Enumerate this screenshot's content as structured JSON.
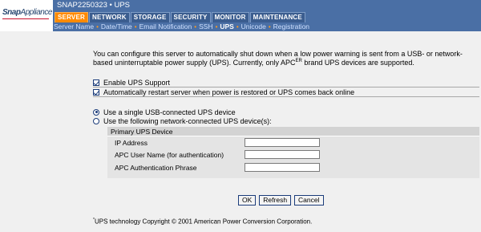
{
  "header": {
    "logo_text_bold": "Snap",
    "logo_text_light": "Appliance",
    "device_title": "SNAP2250323 • UPS"
  },
  "tabs": [
    {
      "label": "SERVER",
      "active": true
    },
    {
      "label": "NETWORK",
      "active": false
    },
    {
      "label": "STORAGE",
      "active": false
    },
    {
      "label": "SECURITY",
      "active": false
    },
    {
      "label": "MONITOR",
      "active": false
    },
    {
      "label": "MAINTENANCE",
      "active": false
    }
  ],
  "subnav": [
    {
      "label": "Server Name",
      "active": false
    },
    {
      "label": "Date/Time",
      "active": false
    },
    {
      "label": "Email Notification",
      "active": false
    },
    {
      "label": "SSH",
      "active": false
    },
    {
      "label": "UPS",
      "active": true
    },
    {
      "label": "Unicode",
      "active": false
    },
    {
      "label": "Registration",
      "active": false
    }
  ],
  "subnav_separator": "•",
  "intro": {
    "text_before": "You can configure this server to automatically shut down when a low power warning is sent from a USB- or network-based uninterruptable power supply (UPS). Currently, only APC",
    "superscript": "ER",
    "text_after": " brand UPS devices are supported."
  },
  "options": {
    "enable_ups": {
      "label": "Enable UPS Support",
      "checked": true
    },
    "auto_restart": {
      "label": "Automatically restart server when power is restored or UPS comes back online",
      "checked": true
    },
    "usb_device": {
      "label": "Use a single USB-connected UPS device",
      "checked": true
    },
    "network_device": {
      "label": "Use the following network-connected UPS device(s):",
      "checked": false
    }
  },
  "primary_device": {
    "header": "Primary UPS Device",
    "ip_address": {
      "label": "IP Address",
      "value": ""
    },
    "apc_username": {
      "label": "APC User Name (for authentication)",
      "value": ""
    },
    "apc_phrase": {
      "label": "APC Authentication Phrase",
      "value": ""
    }
  },
  "buttons": {
    "ok": "OK",
    "refresh": "Refresh",
    "cancel": "Cancel"
  },
  "footnote": {
    "superscript": "*",
    "text": "UPS technology Copyright © 2001  American Power Conversion Corporation."
  },
  "colors": {
    "header_blue": "#4a6fa5",
    "active_tab": "#ff8a00",
    "page_background": "#f0f0f0"
  }
}
